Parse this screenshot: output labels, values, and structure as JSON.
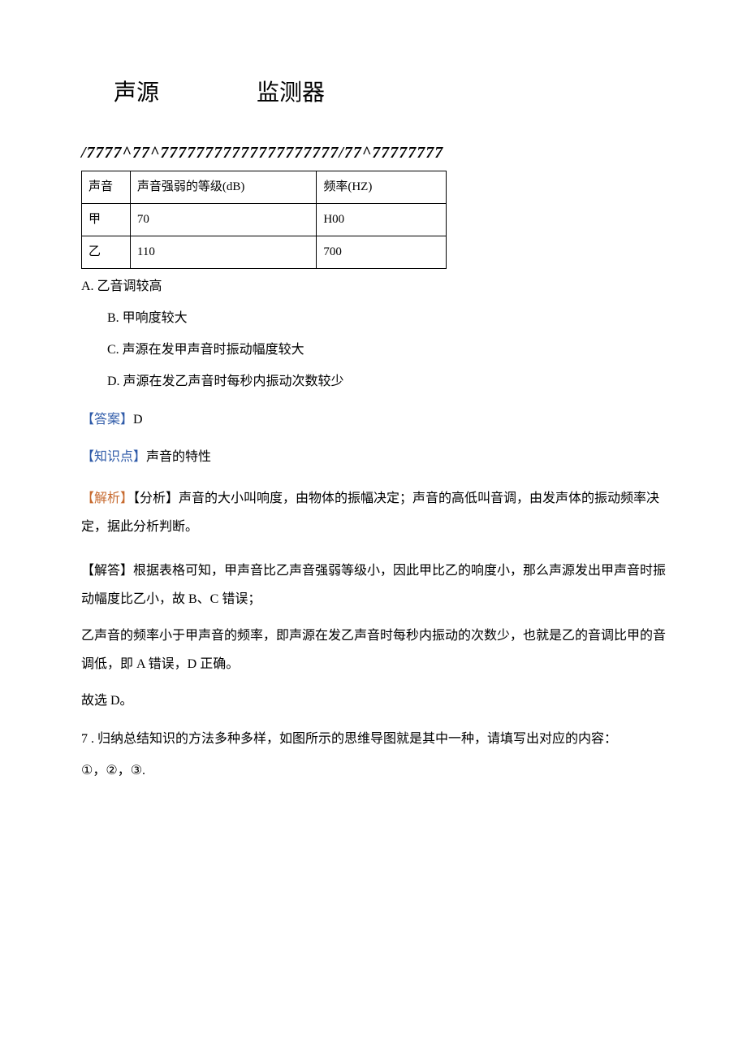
{
  "header": {
    "left": "声源",
    "right": "监测器"
  },
  "scribble": "/7777^77^77777777777777777777/77^77777777",
  "table": {
    "headers": [
      "声音",
      "声音强弱的等级(dB)",
      "频率(HZ)"
    ],
    "rows": [
      [
        "甲",
        "70",
        "H00"
      ],
      [
        "乙",
        "110",
        "700"
      ]
    ]
  },
  "options": {
    "a": "A. 乙音调较高",
    "b": "B. 甲响度较大",
    "c": "C. 声源在发甲声音时振动幅度较大",
    "d": "D. 声源在发乙声音时每秒内振动次数较少"
  },
  "answer": {
    "label": "【答案】",
    "value": "D"
  },
  "knowledge": {
    "label": "【知识点】",
    "value": "声音的特性"
  },
  "analysis": {
    "label1": "【解析】",
    "label2": "【分析】",
    "text": "声音的大小叫响度，由物体的振幅决定；声音的高低叫音调，由发声体的振动频率决定，据此分析判断。"
  },
  "solution": {
    "p1": "【解答】根据表格可知，甲声音比乙声音强弱等级小，因此甲比乙的响度小，那么声源发出甲声音时振动幅度比乙小，故 B、C 错误；",
    "p2": "乙声音的频率小于甲声音的频率，即声源在发乙声音时每秒内振动的次数少，也就是乙的音调比甲的音调低，即 A 错误，D 正确。",
    "p3": "故选 D。"
  },
  "question7": {
    "p1": "7  . 归纳总结知识的方法多种多样，如图所示的思维导图就是其中一种，请填写出对应的内容：",
    "p2": "①，②，③."
  }
}
